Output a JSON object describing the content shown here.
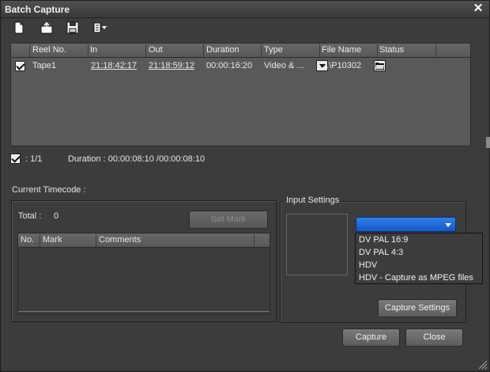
{
  "window": {
    "title": "Batch Capture",
    "close_glyph": "✕"
  },
  "toolbar": {
    "icons": [
      "new-list-icon",
      "import-list-icon",
      "save-list-icon",
      "export-list-icon"
    ]
  },
  "list": {
    "columns": [
      "Reel No.",
      "In",
      "Out",
      "Duration",
      "Type",
      "File Name",
      "Status"
    ],
    "rows": [
      {
        "checked": true,
        "reel": "Tape1",
        "in": "21:18:42:17",
        "out": "21:18:59:12",
        "duration": "00:00:16:20",
        "type": "Video & ...",
        "file": "...\\P10302",
        "status": ""
      }
    ]
  },
  "summary": {
    "count": ": 1/1",
    "duration": "Duration : 00:00:08:10 /00:00:08:10"
  },
  "timecode": {
    "label": "Current Timecode :"
  },
  "marks": {
    "total_label": "Total :",
    "total_value": "0",
    "set_mark": "Set Mark",
    "columns": [
      "No.",
      "Mark",
      "Comments"
    ]
  },
  "input_settings": {
    "label": "Input Settings",
    "selected": "",
    "options": [
      "DV PAL 16:9",
      "DV PAL 4:3",
      "HDV",
      "HDV - Capture as MPEG files"
    ],
    "capture_settings": "Capture Settings"
  },
  "footer": {
    "capture": "Capture",
    "close": "Close"
  },
  "colors": {
    "accent": "#1e6ad8",
    "window_bg": "#3c3c3c",
    "list_bg": "#595959"
  }
}
